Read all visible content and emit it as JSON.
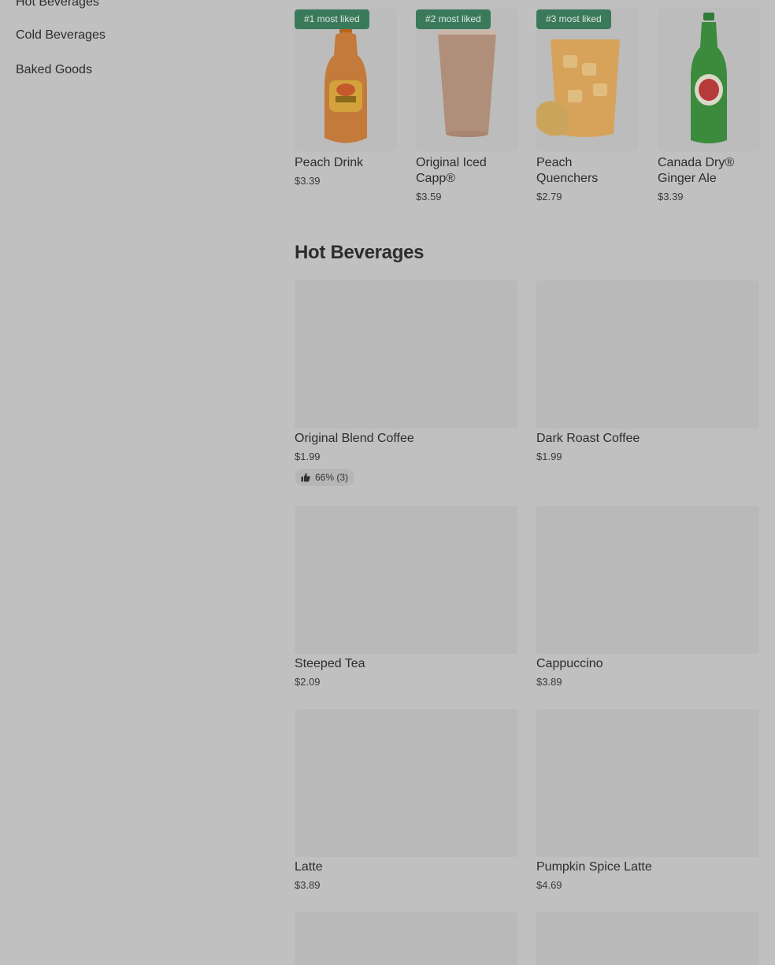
{
  "sidebar": {
    "items": [
      {
        "label": "Hot Beverages"
      },
      {
        "label": "Cold Beverages"
      },
      {
        "label": "Baked Goods"
      }
    ]
  },
  "most_liked": [
    {
      "badge": "#1 most liked",
      "name": "Peach Drink",
      "price": "$3.39",
      "icon": "peach-drink-bottle"
    },
    {
      "badge": "#2 most liked",
      "name": "Original Iced Capp®",
      "price": "$3.59",
      "icon": "iced-capp-cup"
    },
    {
      "badge": "#3 most liked",
      "name": "Peach Quenchers",
      "price": "$2.79",
      "icon": "peach-quencher-cup"
    },
    {
      "badge": "",
      "name": "Canada Dry® Ginger Ale",
      "price": "$3.39",
      "icon": "ginger-ale-bottle"
    }
  ],
  "section": {
    "title": "Hot Beverages"
  },
  "products": [
    {
      "name": "Original Blend Coffee",
      "price": "$1.99",
      "rating": "66% (3)"
    },
    {
      "name": "Dark Roast Coffee",
      "price": "$1.99",
      "rating": ""
    },
    {
      "name": "Steeped Tea",
      "price": "$2.09",
      "rating": ""
    },
    {
      "name": "Cappuccino",
      "price": "$3.89",
      "rating": ""
    },
    {
      "name": "Latte",
      "price": "$3.89",
      "rating": ""
    },
    {
      "name": "Pumpkin Spice Latte",
      "price": "$4.69",
      "rating": ""
    }
  ],
  "colors": {
    "badge": "#3a7a5a",
    "overlay": "#c0c0c0"
  }
}
